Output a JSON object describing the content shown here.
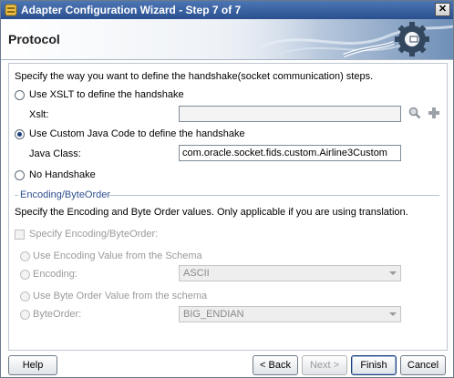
{
  "window": {
    "title": "Adapter Configuration Wizard - Step 7 of 7",
    "close_glyph": "✕"
  },
  "header": {
    "page_title": "Protocol"
  },
  "main": {
    "intro": "Specify the way you want to define the handshake(socket communication) steps.",
    "options": {
      "xslt": {
        "label": "Use XSLT to define the handshake",
        "selected": false,
        "field_label": "Xslt:",
        "field_value": ""
      },
      "custom_java": {
        "label": "Use Custom Java Code to define the handshake",
        "selected": true,
        "field_label": "Java Class:",
        "field_value": "com.oracle.socket.fids.custom.Airline3Custom"
      },
      "no_handshake": {
        "label": "No Handshake",
        "selected": false
      }
    },
    "icons": {
      "search": "magnifier-icon",
      "add": "plus-icon"
    },
    "encoding_section": {
      "legend": "Encoding/ByteOrder",
      "description": "Specify the Encoding and Byte Order values. Only applicable if you are using translation.",
      "specify_checkbox": {
        "label": "Specify Encoding/ByteOrder:",
        "checked": false,
        "enabled": false
      },
      "use_encoding_from_schema": "Use Encoding Value from the Schema",
      "encoding_label": "Encoding:",
      "encoding_value": "ASCII",
      "use_byte_order_from_schema": "Use Byte Order Value from the schema",
      "byte_order_label": "ByteOrder:",
      "byte_order_value": "BIG_ENDIAN"
    }
  },
  "footer": {
    "help": "Help",
    "back": "< Back",
    "next": "Next >",
    "finish": "Finish",
    "cancel": "Cancel"
  },
  "colors": {
    "title_bar": "#2a4f8f",
    "legend": "#2f4f8f",
    "disabled_text": "#9a9a9a"
  }
}
